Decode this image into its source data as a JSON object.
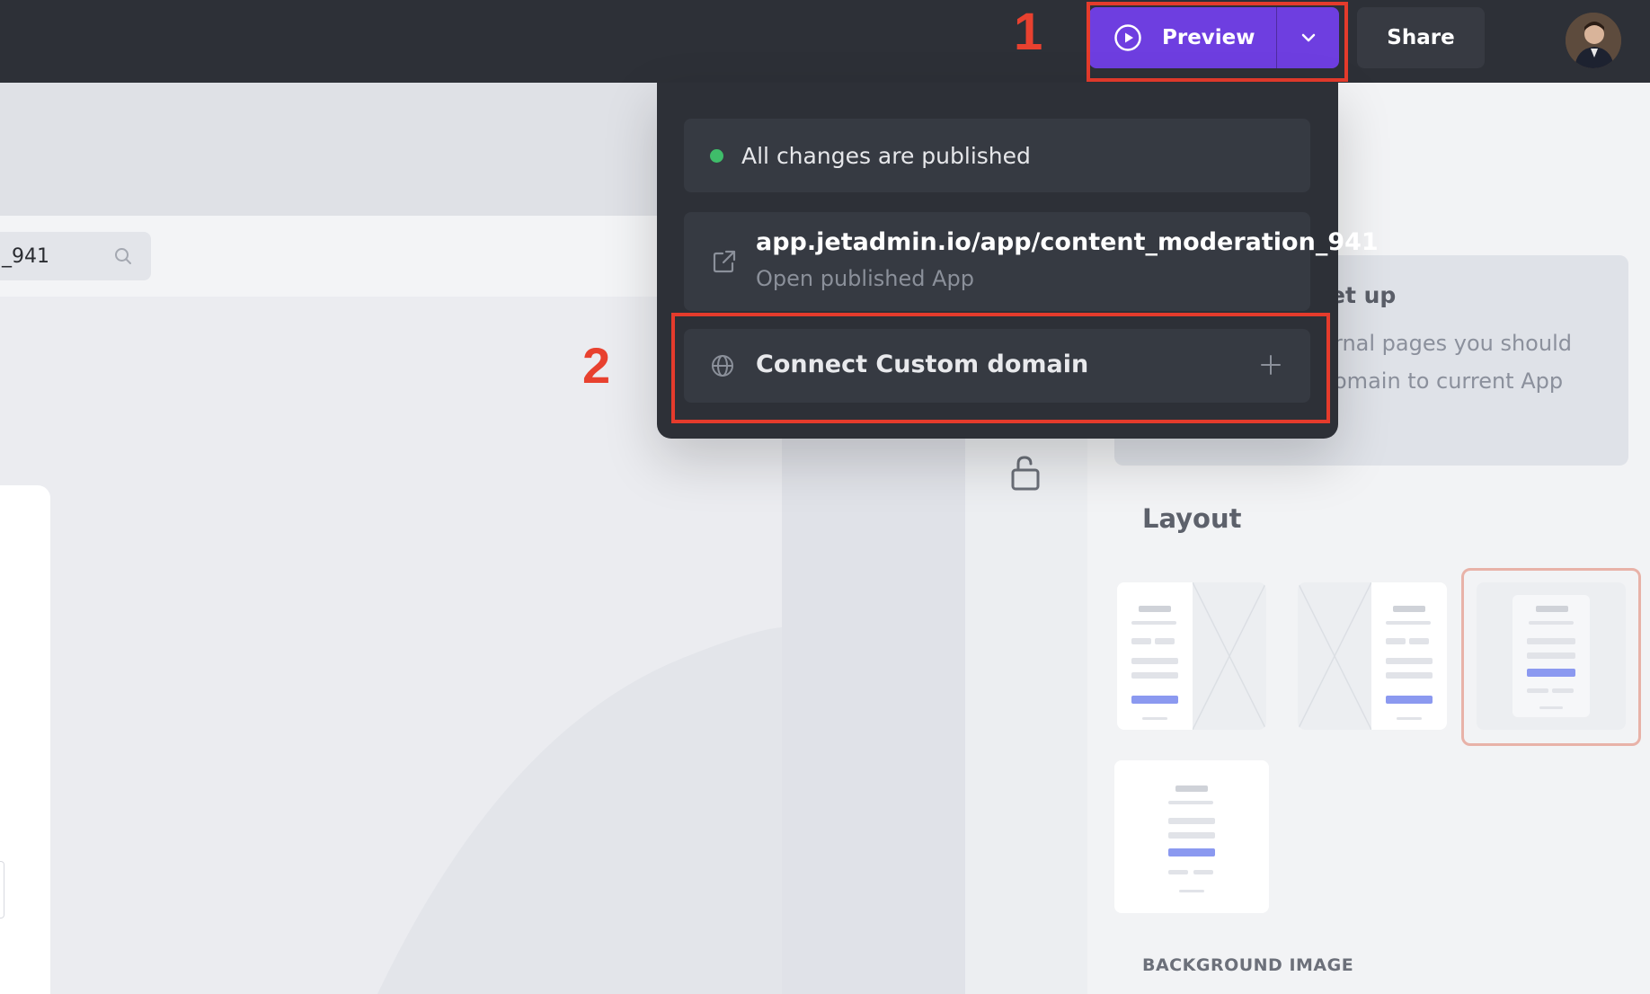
{
  "header": {
    "preview_label": "Preview",
    "share_label": "Share"
  },
  "annotations": {
    "step1": "1",
    "step2": "2"
  },
  "canvas": {
    "search_value": "_941"
  },
  "publish_menu": {
    "status_text": "All changes are published",
    "app_url": "app.jetadmin.io/app/content_moderation_941",
    "open_label": "Open published App",
    "custom_domain_label": "Connect Custom domain"
  },
  "side_panel": {
    "info_title_fragment": "et up",
    "info_line_1": "rnal pages you should",
    "info_line_2": "omain to current App",
    "layout_title": "Layout",
    "background_image_title": "BACKGROUND IMAGE",
    "selected_layout": 3
  },
  "colors": {
    "accent": "#6e3ee0",
    "highlight": "#e53b2c",
    "status_published": "#3fbd6a"
  }
}
